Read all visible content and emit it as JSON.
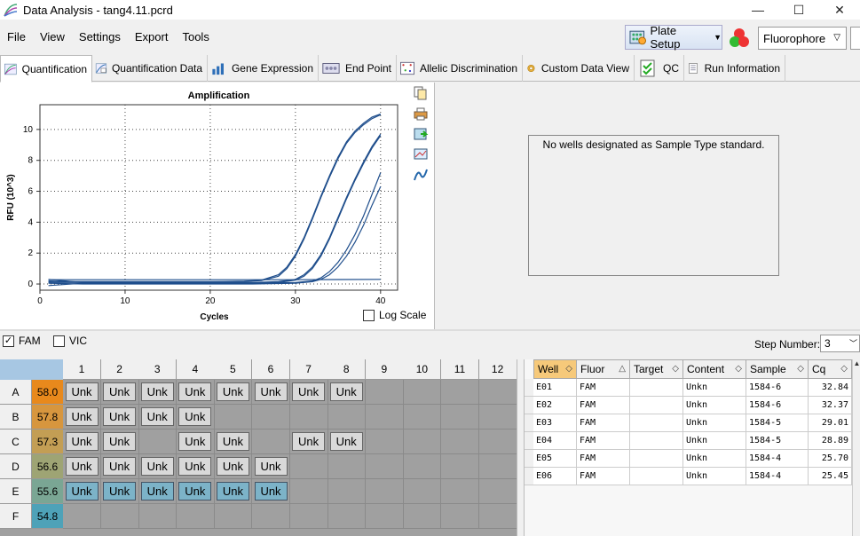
{
  "window": {
    "title": "Data Analysis - tang4.11.pcrd",
    "minimize": "—",
    "maximize": "☐",
    "close": "✕"
  },
  "menu": [
    "File",
    "View",
    "Settings",
    "Export",
    "Tools"
  ],
  "toolbar": {
    "plate_setup": "Plate Setup",
    "fluorophore": "Fluorophore"
  },
  "tabs": [
    {
      "label": "Quantification",
      "icon": "quantification-icon",
      "active": true
    },
    {
      "label": "Quantification Data",
      "icon": "quantification-data-icon"
    },
    {
      "label": "Gene Expression",
      "icon": "gene-expression-icon"
    },
    {
      "label": "End Point",
      "icon": "end-point-icon"
    },
    {
      "label": "Allelic Discrimination",
      "icon": "allelic-discrimination-icon"
    },
    {
      "label": "Custom Data View",
      "icon": "custom-data-view-icon"
    },
    {
      "label": "QC",
      "icon": "qc-icon"
    },
    {
      "label": "Run Information",
      "icon": "run-information-icon"
    }
  ],
  "chart_data": {
    "type": "line",
    "title": "Amplification",
    "xlabel": "Cycles",
    "ylabel": "RFU (10^3)",
    "xlim": [
      0,
      42
    ],
    "ylim": [
      -0.4,
      11.6
    ],
    "xticks": [
      0,
      10,
      20,
      30,
      40
    ],
    "yticks": [
      0,
      2,
      4,
      6,
      8,
      10
    ],
    "grid": true,
    "line_color": "#1f4e8c",
    "series": [
      {
        "values_x": [
          1,
          5,
          10,
          15,
          20,
          24,
          26,
          28,
          29,
          30,
          31,
          32,
          33,
          34,
          35,
          36,
          37,
          38,
          39,
          40
        ],
        "values": [
          0.15,
          0.15,
          0.15,
          0.15,
          0.15,
          0.18,
          0.25,
          0.6,
          1.1,
          1.9,
          3.0,
          4.3,
          5.7,
          7.0,
          8.2,
          9.2,
          9.9,
          10.4,
          10.8,
          11.0
        ]
      },
      {
        "values_x": [
          1,
          5,
          10,
          15,
          20,
          24,
          26,
          28,
          29,
          30,
          31,
          32,
          33,
          34,
          35,
          36,
          37,
          38,
          39,
          40
        ],
        "values": [
          0.1,
          0.1,
          0.12,
          0.12,
          0.12,
          0.15,
          0.22,
          0.5,
          1.0,
          1.8,
          2.9,
          4.2,
          5.6,
          6.9,
          8.1,
          9.1,
          9.8,
          10.3,
          10.7,
          10.95
        ]
      },
      {
        "values_x": [
          1,
          5,
          10,
          15,
          20,
          25,
          28,
          30,
          31,
          32,
          33,
          34,
          35,
          36,
          37,
          38,
          39,
          40
        ],
        "values": [
          0.3,
          0.1,
          0.1,
          0.1,
          0.1,
          0.1,
          0.15,
          0.3,
          0.6,
          1.1,
          1.9,
          3.0,
          4.3,
          5.6,
          6.8,
          7.9,
          8.9,
          9.7
        ]
      },
      {
        "values_x": [
          1,
          5,
          10,
          15,
          20,
          25,
          28,
          30,
          31,
          32,
          33,
          34,
          35,
          36,
          37,
          38,
          39,
          40
        ],
        "values": [
          -0.1,
          0.05,
          0.05,
          0.05,
          0.05,
          0.05,
          0.1,
          0.25,
          0.5,
          1.0,
          1.8,
          2.9,
          4.2,
          5.5,
          6.7,
          7.8,
          8.8,
          9.6
        ]
      },
      {
        "values_x": [
          1,
          5,
          10,
          15,
          20,
          25,
          30,
          32,
          33,
          34,
          35,
          36,
          37,
          38,
          39,
          40
        ],
        "values": [
          0.2,
          0.1,
          0.05,
          0.05,
          0.05,
          0.05,
          0.1,
          0.2,
          0.4,
          0.8,
          1.4,
          2.2,
          3.2,
          4.4,
          5.8,
          7.2
        ]
      },
      {
        "values_x": [
          1,
          5,
          10,
          15,
          20,
          25,
          30,
          32,
          33,
          34,
          35,
          36,
          37,
          38,
          39,
          40
        ],
        "values": [
          0.05,
          0.0,
          0.0,
          0.0,
          0.0,
          0.0,
          0.05,
          0.15,
          0.3,
          0.6,
          1.1,
          1.8,
          2.7,
          3.8,
          5.1,
          6.3
        ]
      },
      {
        "values_x": [
          1,
          10,
          20,
          30,
          40
        ],
        "values": [
          0.28,
          0.28,
          0.28,
          0.28,
          0.3
        ]
      }
    ]
  },
  "chart": {
    "log_scale": "Log Scale"
  },
  "std_panel": {
    "message": "No wells designated as Sample Type standard."
  },
  "filters": {
    "fam": "FAM",
    "vic": "VIC",
    "step_label": "Step Number:",
    "step_value": "3"
  },
  "plate": {
    "columns": [
      "1",
      "2",
      "3",
      "4",
      "5",
      "6",
      "7",
      "8",
      "9",
      "10",
      "11",
      "12"
    ],
    "rows": [
      {
        "label": "A",
        "temp": "58.0",
        "color": "#e8891c",
        "wells": [
          "Unk",
          "Unk",
          "Unk",
          "Unk",
          "Unk",
          "Unk",
          "Unk",
          "Unk"
        ],
        "filled": [
          1,
          2,
          3,
          4,
          5,
          6,
          7,
          8
        ]
      },
      {
        "label": "B",
        "temp": "57.8",
        "color": "#d7963e",
        "wells": [
          "Unk",
          "Unk",
          "Unk",
          "Unk"
        ],
        "filled": [
          1,
          2,
          3,
          4
        ]
      },
      {
        "label": "C",
        "temp": "57.3",
        "color": "#c39e54",
        "wells": [
          "Unk",
          "Unk",
          "Unk",
          "Unk",
          "Unk",
          "Unk"
        ],
        "filled": [
          1,
          2,
          4,
          5,
          7,
          8
        ]
      },
      {
        "label": "D",
        "temp": "56.6",
        "color": "#9ea474",
        "wells": [
          "Unk",
          "Unk",
          "Unk",
          "Unk",
          "Unk",
          "Unk"
        ],
        "filled": [
          1,
          2,
          3,
          4,
          5,
          6
        ]
      },
      {
        "label": "E",
        "temp": "55.6",
        "color": "#7aa694",
        "wells": [
          "Unk",
          "Unk",
          "Unk",
          "Unk",
          "Unk",
          "Unk"
        ],
        "filled": [
          1,
          2,
          3,
          4,
          5,
          6
        ],
        "selected": true
      },
      {
        "label": "F",
        "temp": "54.8",
        "color": "#4ea2b8",
        "wells": [],
        "filled": []
      }
    ]
  },
  "table": {
    "headers": [
      "Well",
      "Fluor",
      "Target",
      "Content",
      "Sample",
      "Cq"
    ],
    "rows": [
      [
        "E01",
        "FAM",
        "",
        "Unkn",
        "1584-6",
        "32.84"
      ],
      [
        "E02",
        "FAM",
        "",
        "Unkn",
        "1584-6",
        "32.37"
      ],
      [
        "E03",
        "FAM",
        "",
        "Unkn",
        "1584-5",
        "29.01"
      ],
      [
        "E04",
        "FAM",
        "",
        "Unkn",
        "1584-5",
        "28.89"
      ],
      [
        "E05",
        "FAM",
        "",
        "Unkn",
        "1584-4",
        "25.70"
      ],
      [
        "E06",
        "FAM",
        "",
        "Unkn",
        "1584-4",
        "25.45"
      ]
    ]
  }
}
